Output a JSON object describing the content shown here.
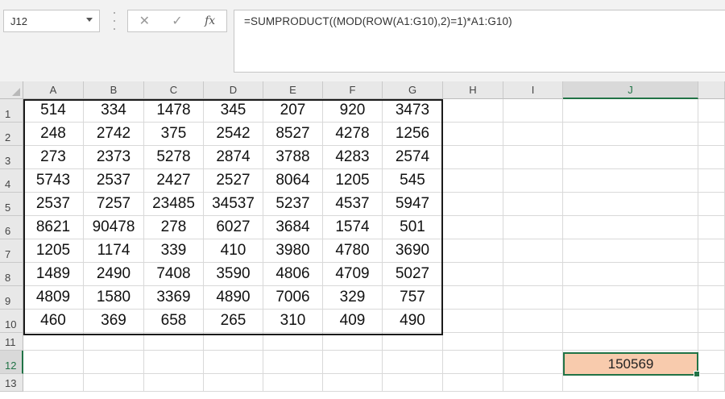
{
  "namebox": {
    "value": "J12"
  },
  "formula_bar": {
    "cancel_icon": "✕",
    "enter_icon": "✓",
    "fx_label": "fx",
    "formula": "=SUMPRODUCT((MOD(ROW(A1:G10),2)=1)*A1:G10)"
  },
  "columns": [
    "A",
    "B",
    "C",
    "D",
    "E",
    "F",
    "G",
    "H",
    "I",
    "J"
  ],
  "rows": [
    "1",
    "2",
    "3",
    "4",
    "5",
    "6",
    "7",
    "8",
    "9",
    "10",
    "11",
    "12",
    "13"
  ],
  "data": [
    [
      "514",
      "334",
      "1478",
      "345",
      "207",
      "920",
      "3473"
    ],
    [
      "248",
      "2742",
      "375",
      "2542",
      "8527",
      "4278",
      "1256"
    ],
    [
      "273",
      "2373",
      "5278",
      "2874",
      "3788",
      "4283",
      "2574"
    ],
    [
      "5743",
      "2537",
      "2427",
      "2527",
      "8064",
      "1205",
      "545"
    ],
    [
      "2537",
      "7257",
      "23485",
      "34537",
      "5237",
      "4537",
      "5947"
    ],
    [
      "8621",
      "90478",
      "278",
      "6027",
      "3684",
      "1574",
      "501"
    ],
    [
      "1205",
      "1174",
      "339",
      "410",
      "3980",
      "4780",
      "3690"
    ],
    [
      "1489",
      "2490",
      "7408",
      "3590",
      "4806",
      "4709",
      "5027"
    ],
    [
      "4809",
      "1580",
      "3369",
      "4890",
      "7006",
      "329",
      "757"
    ],
    [
      "460",
      "369",
      "658",
      "265",
      "310",
      "409",
      "490"
    ]
  ],
  "result_cell": {
    "ref": "J12",
    "value": "150569"
  },
  "colors": {
    "accent": "#217346",
    "result_fill": "#f8cbad"
  }
}
